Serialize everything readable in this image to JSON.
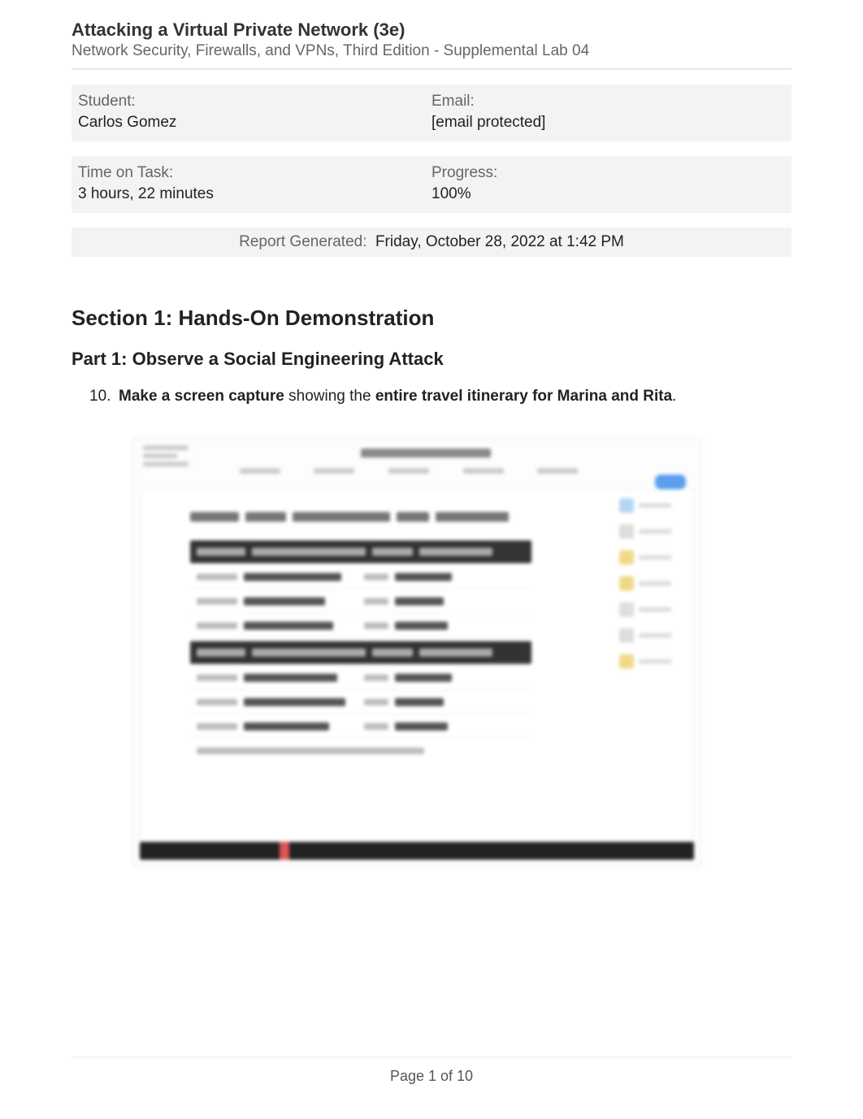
{
  "header": {
    "title": "Attacking a Virtual Private Network (3e)",
    "subtitle": "Network Security, Firewalls, and VPNs, Third Edition - Supplemental Lab 04"
  },
  "info": {
    "student_label": "Student:",
    "student_value": "Carlos Gomez",
    "email_label": "Email:",
    "email_value": "[email protected]",
    "time_label": "Time on Task:",
    "time_value": "3 hours, 22 minutes",
    "progress_label": "Progress:",
    "progress_value": "100%"
  },
  "report": {
    "label": "Report Generated:",
    "value": "Friday, October 28, 2022 at 1:42 PM"
  },
  "section": {
    "title": "Section 1: Hands-On Demonstration",
    "part_title": "Part 1: Observe a Social Engineering Attack"
  },
  "question": {
    "number": "10.",
    "bold1": "Make a screen capture",
    "mid": " showing the ",
    "bold2": "entire travel itinerary for Marina and Rita",
    "end": "."
  },
  "footer": {
    "page": "Page 1 of 10"
  }
}
